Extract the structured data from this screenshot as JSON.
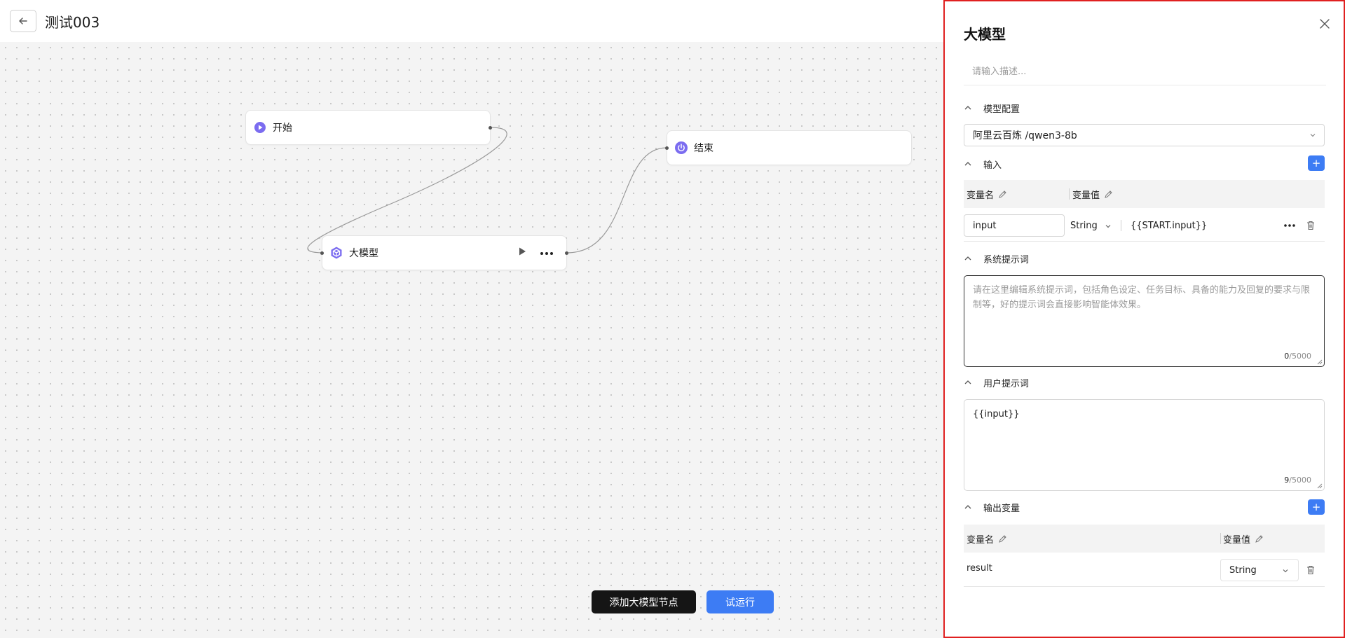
{
  "header": {
    "title": "测试003"
  },
  "canvas": {
    "nodes": {
      "start": {
        "label": "开始"
      },
      "end": {
        "label": "结束"
      },
      "llm": {
        "label": "大模型"
      }
    },
    "buttons": {
      "add_llm_node": "添加大模型节点",
      "trial_run": "试运行"
    }
  },
  "panel": {
    "title": "大模型",
    "description_placeholder": "请输入描述...",
    "model_config": {
      "title": "模型配置",
      "selected_model": "阿里云百炼 /qwen3-8b"
    },
    "input": {
      "title": "输入",
      "col_name": "变量名",
      "col_value": "变量值",
      "rows": [
        {
          "name": "input",
          "type": "String",
          "value": "{{START.input}}"
        }
      ]
    },
    "system_prompt": {
      "title": "系统提示词",
      "placeholder": "请在这里编辑系统提示词，包括角色设定、任务目标、具备的能力及回复的要求与限制等，好的提示词会直接影响智能体效果。",
      "count": "0",
      "max": "/5000"
    },
    "user_prompt": {
      "title": "用户提示词",
      "value": "{{input}}",
      "count": "9",
      "max": "/5000"
    },
    "output": {
      "title": "输出变量",
      "col_name": "变量名",
      "col_value": "变量值",
      "rows": [
        {
          "name": "result",
          "type": "String"
        }
      ]
    }
  },
  "colors": {
    "accent": "#3d7cf4",
    "node_icon": "#7b6cf0",
    "highlight_border": "#e02020"
  },
  "icons": [
    "arrow-left-icon",
    "play-circle-icon",
    "power-icon",
    "cube-icon",
    "play-icon",
    "more-icon",
    "close-icon",
    "chevron-up-icon",
    "chevron-down-icon",
    "plus-icon",
    "edit-icon",
    "trash-icon"
  ]
}
